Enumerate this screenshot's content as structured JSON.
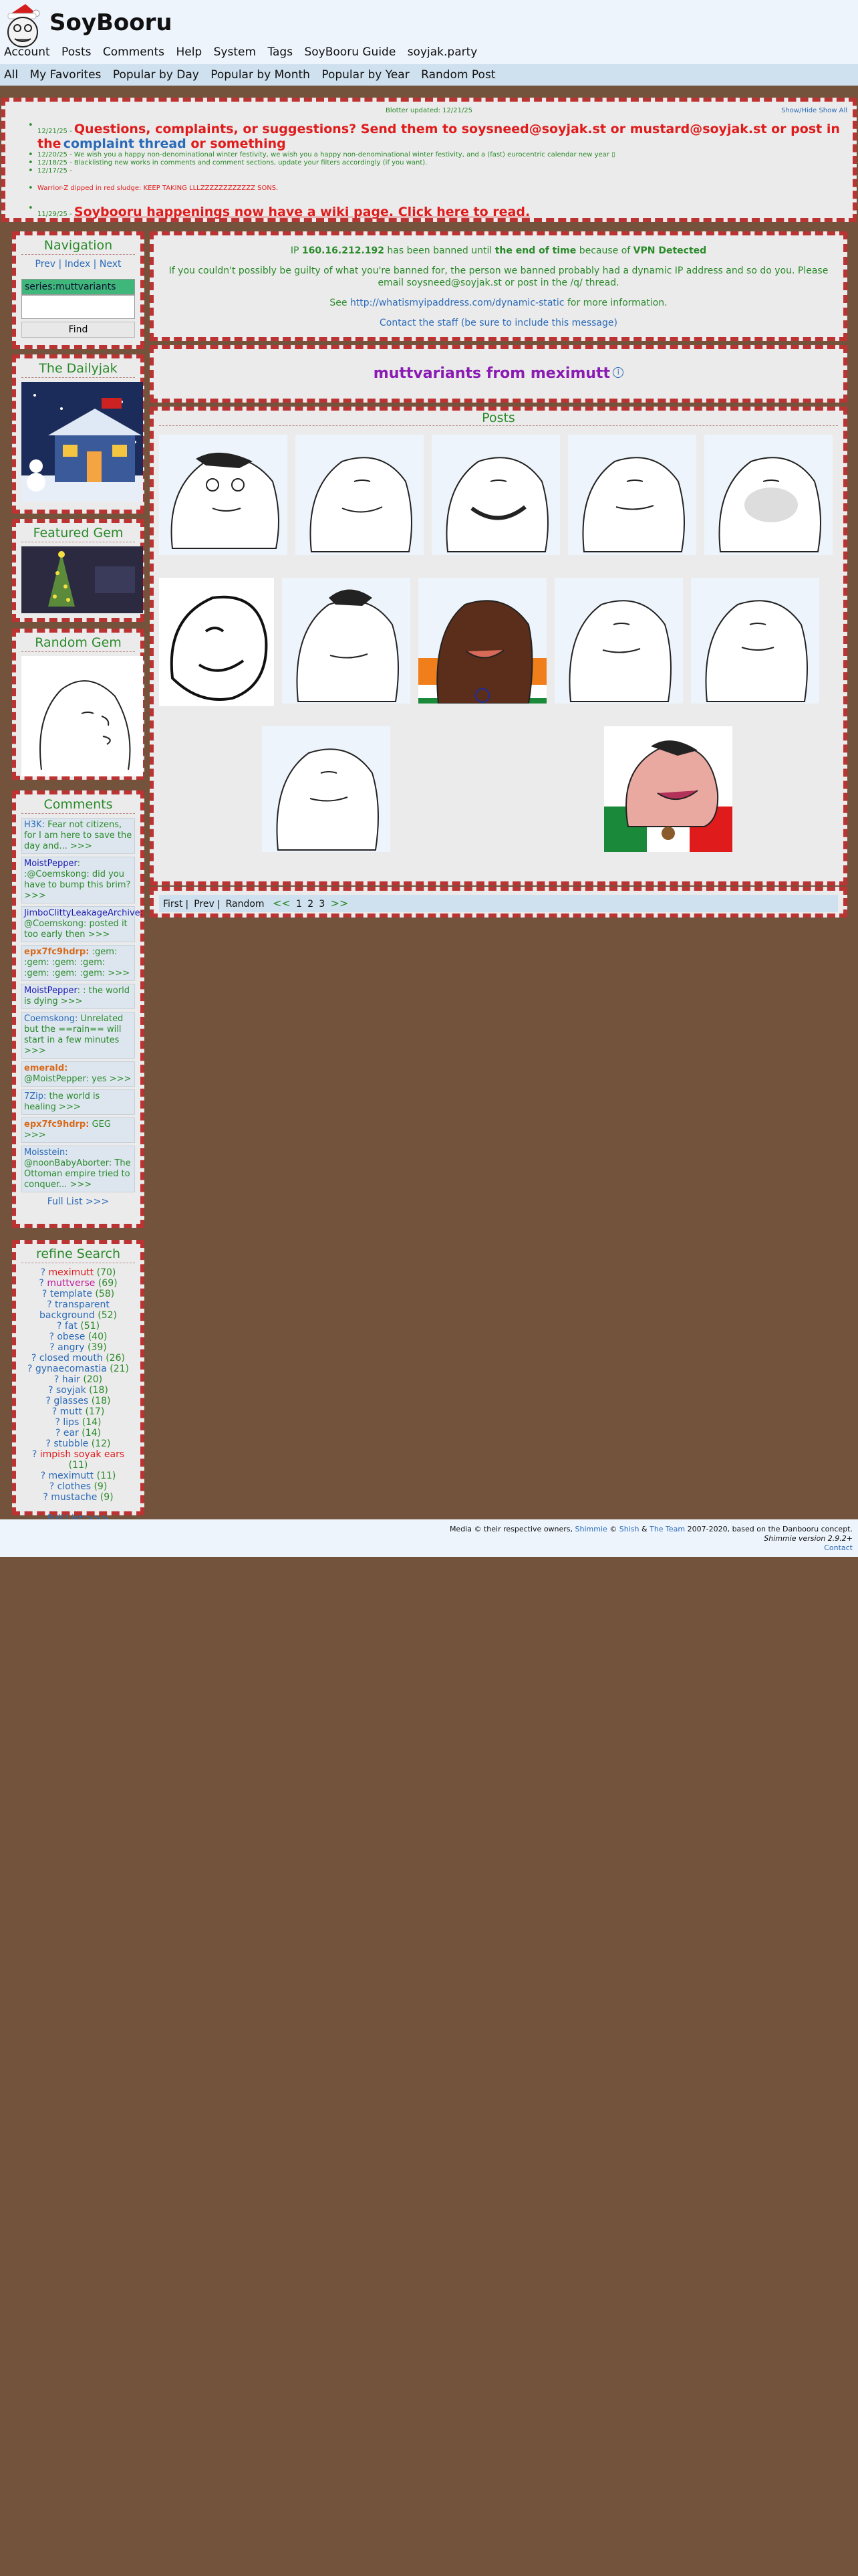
{
  "site": {
    "name": "SoyBooru"
  },
  "menu": [
    "Account",
    "Posts",
    "Comments",
    "Help",
    "System",
    "Tags",
    "SoyBooru Guide",
    "soyjak.party"
  ],
  "submenu": [
    "All",
    "My Favorites",
    "Popular by Day",
    "Popular by Month",
    "Popular by Year",
    "Random Post"
  ],
  "blotter": {
    "updated": "Blotter updated: 12/21/25",
    "show_hide": "Show/Hide Show All",
    "items": [
      {
        "date": "12/21/25 -",
        "text_a": "Questions, complaints, or suggestions? Send them to soysneed@soyjak.st or mustard@soyjak.st or post in the",
        "text_b": "complaint thread",
        "text_c": " or something"
      },
      {
        "date": "12/20/25 -",
        "text": "We wish you a happy non-denominational winter festivity, we wish you a happy non-denominational winter festivity, and a (fast) eurocentric calendar new year ▯"
      },
      {
        "date": "12/18/25 -",
        "text": "Blacklisting new works in comments and comment sections, update your filters accordingly (if you want)."
      },
      {
        "date": "12/17/25 -",
        "text": ""
      },
      {
        "date": "",
        "text": "Warrior-Z dipped in red sludge: KEEP TAKING LLLZZZZZZZZZZZZ SONS."
      },
      {
        "date": "11/29/25 -",
        "text": "Soybooru happenings now have a wiki page. Click here to read."
      }
    ]
  },
  "navigation": {
    "title": "Navigation",
    "prev": "Prev",
    "index": "Index",
    "next": "Next",
    "search_value": "series:muttvariants",
    "find": "Find"
  },
  "dailyjak": {
    "title": "The Dailyjak"
  },
  "featured": {
    "title": "Featured Gem"
  },
  "random": {
    "title": "Random Gem"
  },
  "comments": {
    "title": "Comments",
    "items": [
      {
        "user": "H3K:",
        "text": " Fear not citizens, for I am here to save the day and... >>>"
      },
      {
        "user": "MoistPepper",
        "text": ": :@Coemskong: did you have to bump this brim? >>>"
      },
      {
        "user": "JimboClittyLeakageArchive:",
        "text": " @Coemskong: posted it too early then >>>"
      },
      {
        "user": "epx7fc9hdrp:",
        "text": " :gem: :gem: :gem: :gem: :gem: :gem: :gem: >>>"
      },
      {
        "user": "MoistPepper",
        "text": ": : the world is dying >>>"
      },
      {
        "user": "Coemskong:",
        "text": " Unrelated but the ==rain== will start in a few minutes >>>"
      },
      {
        "user": "emerald:",
        "text": " @MoistPepper: yes >>>"
      },
      {
        "user": "7Zip:",
        "text": " the world is healing >>>"
      },
      {
        "user": "epx7fc9hdrp:",
        "text": " GEG >>>"
      },
      {
        "user": "Moisstein:",
        "text": " @noonBabyAborter: The Ottoman empire tried to conquer... >>>"
      }
    ],
    "full_list": "Full List >>>"
  },
  "refine": {
    "title": "refine Search",
    "tags": [
      {
        "name": "meximutt",
        "count": "(70)",
        "color": "#e01b1b"
      },
      {
        "name": "muttverse",
        "count": "(69)",
        "color": "#c01b9b"
      },
      {
        "name": "template",
        "count": "(58)",
        "color": "#2a6ab8"
      },
      {
        "name": "transparent background",
        "count": "(52)",
        "color": "#2a6ab8"
      },
      {
        "name": "fat",
        "count": "(51)",
        "color": "#2a6ab8"
      },
      {
        "name": "obese",
        "count": "(40)",
        "color": "#2a6ab8"
      },
      {
        "name": "angry",
        "count": "(39)",
        "color": "#2a6ab8"
      },
      {
        "name": "closed mouth",
        "count": "(26)",
        "color": "#2a6ab8"
      },
      {
        "name": "gynaecomastia",
        "count": "(21)",
        "color": "#2a6ab8"
      },
      {
        "name": "hair",
        "count": "(20)",
        "color": "#2a6ab8"
      },
      {
        "name": "soyjak",
        "count": "(18)",
        "color": "#2a6ab8"
      },
      {
        "name": "glasses",
        "count": "(18)",
        "color": "#2a6ab8"
      },
      {
        "name": "mutt",
        "count": "(17)",
        "color": "#2a6ab8"
      },
      {
        "name": "lips",
        "count": "(14)",
        "color": "#2a6ab8"
      },
      {
        "name": "ear",
        "count": "(14)",
        "color": "#2a6ab8"
      },
      {
        "name": "stubble",
        "count": "(12)",
        "color": "#2a6ab8"
      },
      {
        "name": "impish soyak ears",
        "count": "(11)",
        "color": "#e01b1b"
      },
      {
        "name": "meximutt",
        "count": "(11)",
        "color": "#2a6ab8"
      },
      {
        "name": "clothes",
        "count": "(9)",
        "color": "#2a6ab8"
      },
      {
        "name": "mustache",
        "count": "(9)",
        "color": "#2a6ab8"
      }
    ],
    "full_list": "Full List >>>"
  },
  "ban": {
    "line1_a": "IP ",
    "ip": "160.16.212.192",
    "line1_b": " has been banned until ",
    "until": "the end of time",
    "line1_c": " because of ",
    "reason": "VPN Detected",
    "line2": "If you couldn't possibly be guilty of what you're banned for, the person we banned probably had a dynamic IP address and so do you. Please email soysneed@soyjak.st or post in the /q/ thread.",
    "line3_a": "See ",
    "link": "http://whatismyipaddress.com/dynamic-static",
    "line3_b": " for more information.",
    "line4": "Contact the staff (be sure to include this message)"
  },
  "series_title": "muttvariants from meximutt",
  "posts": {
    "title": "Posts"
  },
  "paginator": {
    "first": "First",
    "prev": "Prev",
    "random": "Random",
    "prev_arrow": "<<",
    "pages": [
      "1",
      "2",
      "3"
    ],
    "next_arrow": ">>"
  },
  "footer": {
    "line1_a": "Media © their respective owners, ",
    "shimmie": "Shimmie",
    "line1_b": " © ",
    "shish": "Shish",
    "line1_c": " & ",
    "team": "The Team",
    "line1_d": " 2007-2020, based on the Danbooru concept.",
    "line2": "Shimmie version 2.9.2+",
    "contact": "Contact"
  }
}
